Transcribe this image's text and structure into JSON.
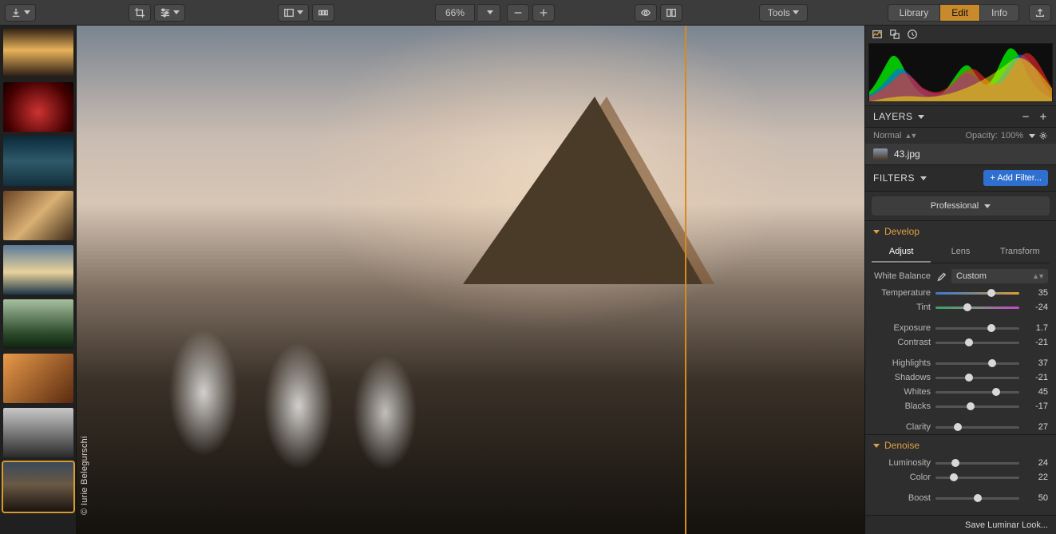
{
  "toolbar": {
    "zoom_value": "66%",
    "tools_label": "Tools",
    "tabs": {
      "library": "Library",
      "edit": "Edit",
      "info": "Info"
    }
  },
  "canvas": {
    "credit": "© Iurie Belegurschi"
  },
  "panel": {
    "layers": {
      "title": "LAYERS",
      "blend_mode": "Normal",
      "opacity_label": "Opacity:",
      "opacity_value": "100%",
      "items": [
        {
          "name": "43.jpg"
        }
      ]
    },
    "filters": {
      "title": "FILTERS",
      "add_filter": "+ Add Filter...",
      "preset": "Professional"
    },
    "develop": {
      "title": "Develop",
      "subtabs": {
        "adjust": "Adjust",
        "lens": "Lens",
        "transform": "Transform"
      },
      "white_balance_label": "White Balance",
      "white_balance_value": "Custom",
      "sliders": {
        "temperature": {
          "label": "Temperature",
          "value": 35
        },
        "tint": {
          "label": "Tint",
          "value": -24
        },
        "exposure": {
          "label": "Exposure",
          "value": 1.7
        },
        "contrast": {
          "label": "Contrast",
          "value": -21
        },
        "highlights": {
          "label": "Highlights",
          "value": 37
        },
        "shadows": {
          "label": "Shadows",
          "value": -21
        },
        "whites": {
          "label": "Whites",
          "value": 45
        },
        "blacks": {
          "label": "Blacks",
          "value": -17
        },
        "clarity": {
          "label": "Clarity",
          "value": 27
        }
      }
    },
    "denoise": {
      "title": "Denoise",
      "sliders": {
        "luminosity": {
          "label": "Luminosity",
          "value": 24
        },
        "color": {
          "label": "Color",
          "value": 22
        },
        "boost": {
          "label": "Boost",
          "value": 50
        }
      }
    },
    "save_look": "Save Luminar Look..."
  }
}
